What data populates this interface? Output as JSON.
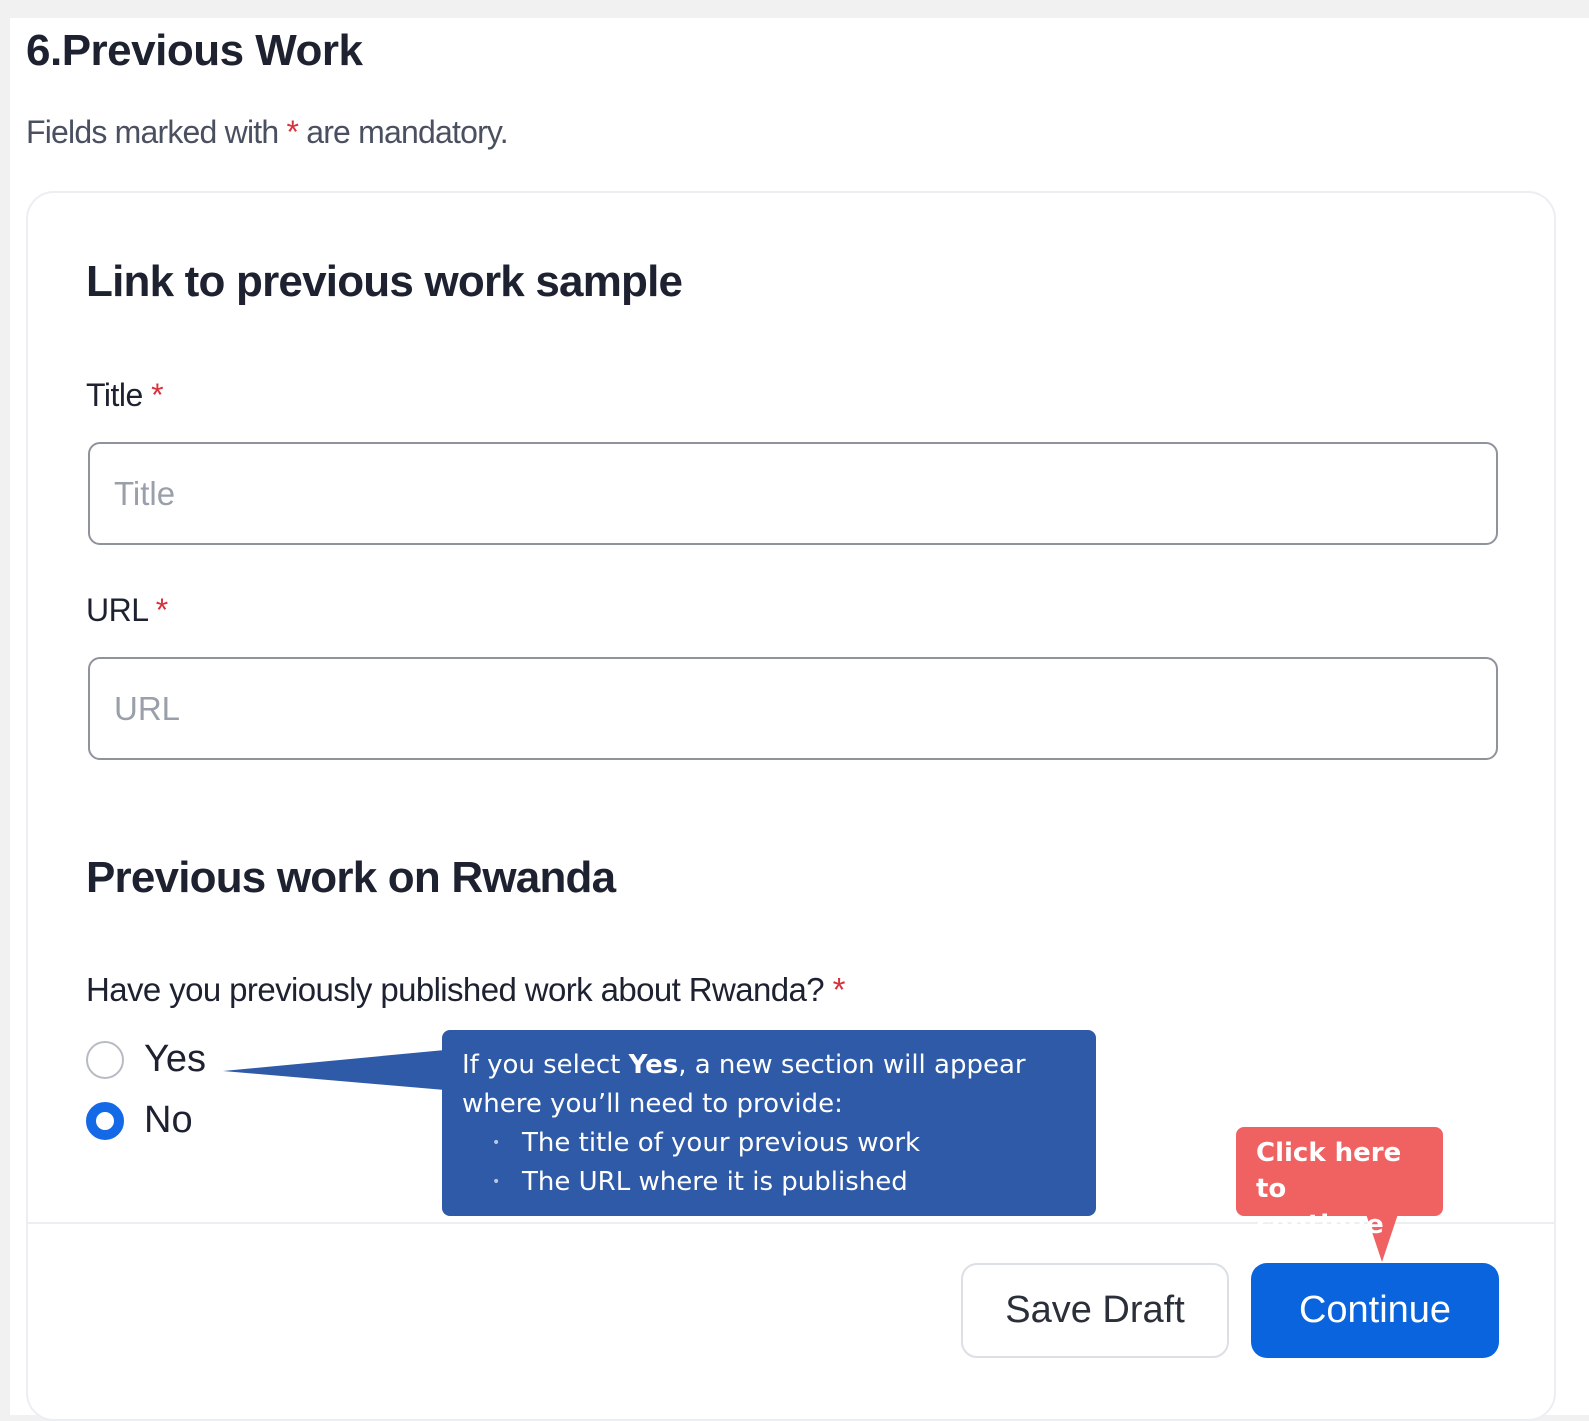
{
  "header": {
    "title": "6.Previous Work",
    "mandatory_note_prefix": "Fields marked with",
    "mandatory_star": "*",
    "mandatory_note_suffix": "are mandatory."
  },
  "work_sample": {
    "heading": "Link to previous work sample",
    "title_label": "Title",
    "title_placeholder": "Title",
    "title_value": "",
    "url_label": "URL",
    "url_placeholder": "URL",
    "url_value": "",
    "required_star": "*"
  },
  "rwanda": {
    "heading": "Previous work on Rwanda",
    "question": "Have you previously published work about Rwanda?",
    "required_star": "*",
    "options": [
      {
        "label": "Yes",
        "selected": false
      },
      {
        "label": "No",
        "selected": true
      }
    ]
  },
  "actions": {
    "save_draft_label": "Save Draft",
    "continue_label": "Continue"
  },
  "callouts": {
    "info_prefix": "If you select",
    "info_bold": "Yes",
    "info_suffix": ", a new section will appear where you’ll need to provide:",
    "info_items": [
      "The title of your previous work",
      "The URL where it is published"
    ],
    "info_color": "#2e5aa8",
    "continue_hint_line1": "Click here",
    "continue_hint_line2": "to continue",
    "continue_hint_color": "#f06262"
  },
  "colors": {
    "accent": "#0a64dd",
    "required": "#d8313c"
  }
}
